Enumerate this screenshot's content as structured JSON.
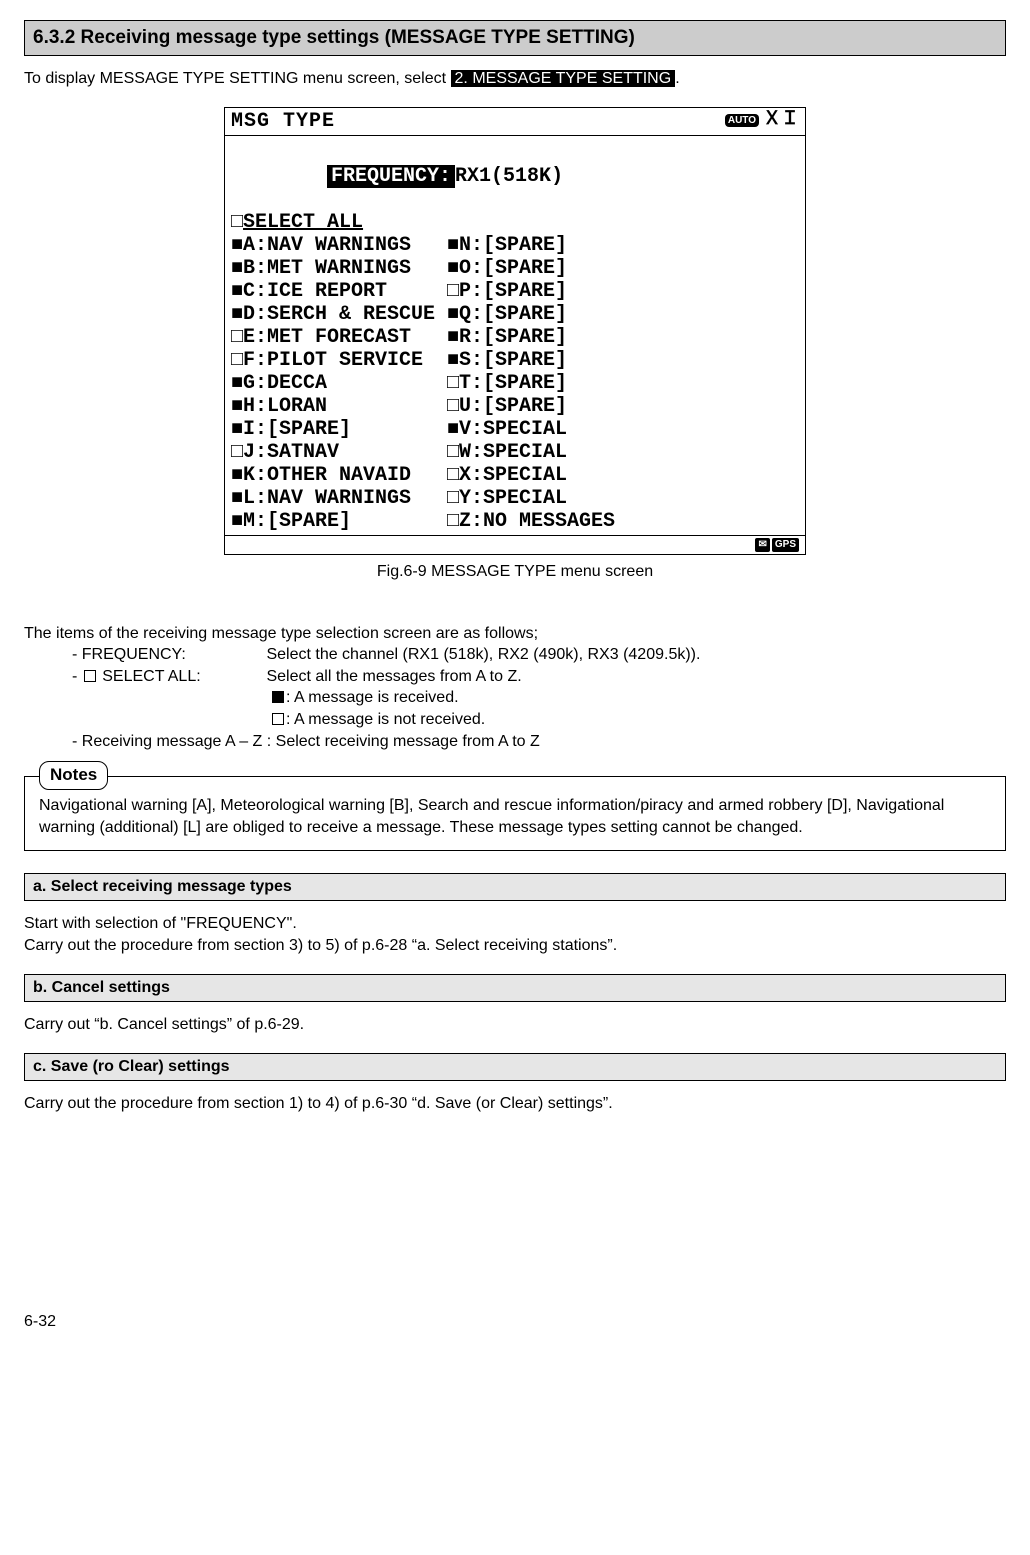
{
  "header": {
    "title": "6.3.2 Receiving message type settings (MESSAGE TYPE SETTING)"
  },
  "intro": {
    "pre": "To display MESSAGE TYPE SETTING menu screen, select ",
    "highlight": "2. MESSAGE TYPE SETTING",
    "post": "."
  },
  "screen": {
    "title": "MSG TYPE",
    "auto_label": "AUTO",
    "xi": "ＸＩ",
    "freq_label": "FREQUENCY:",
    "freq_value": "RX1(518K)",
    "select_all_prefix": "□",
    "select_all": "SELECT ALL",
    "rows": [
      {
        "l": "■A:NAV WARNINGS   ",
        "r": "■N:[SPARE]"
      },
      {
        "l": "■B:MET WARNINGS   ",
        "r": "■O:[SPARE]"
      },
      {
        "l": "■C:ICE REPORT     ",
        "r": "□P:[SPARE]"
      },
      {
        "l": "■D:SERCH & RESCUE ",
        "r": "■Q:[SPARE]"
      },
      {
        "l": "□E:MET FORECAST   ",
        "r": "■R:[SPARE]"
      },
      {
        "l": "□F:PILOT SERVICE  ",
        "r": "■S:[SPARE]"
      },
      {
        "l": "■G:DECCA          ",
        "r": "□T:[SPARE]"
      },
      {
        "l": "■H:LORAN          ",
        "r": "□U:[SPARE]"
      },
      {
        "l": "■I:[SPARE]        ",
        "r": "■V:SPECIAL"
      },
      {
        "l": "□J:SATNAV         ",
        "r": "□W:SPECIAL"
      },
      {
        "l": "■K:OTHER NAVAID   ",
        "r": "□X:SPECIAL"
      },
      {
        "l": "■L:NAV WARNINGS   ",
        "r": "□Y:SPECIAL"
      },
      {
        "l": "■M:[SPARE]        ",
        "r": "□Z:NO MESSAGES"
      }
    ],
    "footer_icon1": "✉",
    "footer_icon2": "GPS"
  },
  "caption": "Fig.6-9 MESSAGE TYPE menu screen",
  "items": {
    "intro": "The items of the receiving message type selection screen are as follows;",
    "freq_label": "- FREQUENCY:",
    "freq_desc": "Select the channel (RX1 (518k), RX2 (490k), RX3 (4209.5k)).",
    "selectall_label_pre": "- ",
    "selectall_label_post": " SELECT ALL:",
    "selectall_desc": "Select all the messages from A to Z.",
    "filled_desc": ": A message is received.",
    "empty_desc": ": A message is not received.",
    "recv_line": "- Receiving message A – Z : Select receiving message from A to Z"
  },
  "notes": {
    "label": "Notes",
    "text": "Navigational warning [A], Meteorological warning [B], Search and rescue information/piracy and armed robbery [D], Navigational warning (additional) [L] are obliged to receive a message. These message types setting cannot be changed."
  },
  "sub_a": {
    "title": "a. Select receiving message types",
    "line1": "Start with selection of \"FREQUENCY\".",
    "line2": "Carry out the procedure from section 3) to 5) of p.6-28 “a. Select receiving stations”."
  },
  "sub_b": {
    "title": "b. Cancel settings",
    "line": "Carry out “b. Cancel settings” of p.6-29."
  },
  "sub_c": {
    "title": "c. Save (ro Clear) settings",
    "line": "Carry out the procedure from section 1) to 4) of p.6-30 “d. Save (or Clear) settings”."
  },
  "page_number": "6-32"
}
